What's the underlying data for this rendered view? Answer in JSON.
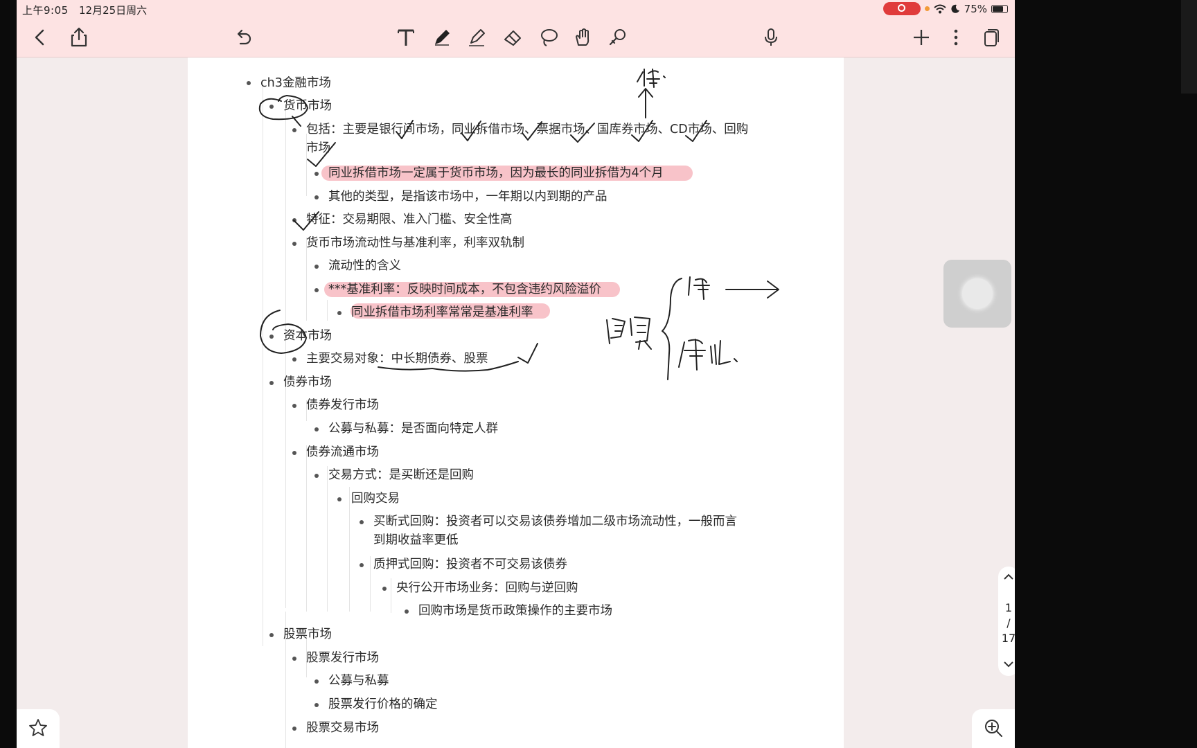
{
  "status_bar": {
    "time": "上午9:05",
    "date": "12月25日周六",
    "battery": "75%"
  },
  "toolbar": {
    "left_icons": [
      "back-icon",
      "share-icon",
      "undo-icon"
    ],
    "tools": [
      "text-tool-icon",
      "pen-icon",
      "highlighter-icon",
      "eraser-icon",
      "lasso-icon",
      "hand-icon",
      "shape-tool-icon"
    ],
    "right_icons": [
      "microphone-icon",
      "plus-icon",
      "more-icon",
      "pages-icon"
    ]
  },
  "outline": {
    "root": "ch3金融市场",
    "money_market": "货币市场",
    "mm_include": "包括：主要是银行间市场，同业拆借市场、票据市场、国库券市场、CD市场、回购市场",
    "mm_include_a": "同业拆借市场一定属于货币市场，因为最长的同业拆借为4个月",
    "mm_include_b": "其他的类型，是指该市场中，一年期以内到期的产品",
    "mm_feature": "特征：交易期限、准入门槛、安全性高",
    "mm_rate": "货币市场流动性与基准利率，利率双轨制",
    "mm_rate_a": "流动性的含义",
    "mm_rate_b": "***基准利率：反映时间成本，不包含违约风险溢价",
    "mm_rate_b1": "同业拆借市场利率常常是基准利率",
    "capital_market": "资本市场",
    "cm_object": "主要交易对象：中长期债券、股票",
    "bond_market": "债券市场",
    "bm_issue": "债券发行市场",
    "bm_issue_a": "公募与私募：是否面向特定人群",
    "bm_trade": "债券流通市场",
    "bm_trade_a": "交易方式：是买断还是回购",
    "bm_repo": "回购交易",
    "bm_repo_a": "买断式回购：投资者可以交易该债券增加二级市场流动性，一般而言到期收益率更低",
    "bm_repo_b": "质押式回购：投资者不可交易该债券",
    "bm_repo_b1": "央行公开市场业务：回购与逆回购",
    "bm_repo_b2": "回购市场是货币政策操作的主要市场",
    "stock_market": "股票市场",
    "sm_issue": "股票发行市场",
    "sm_issue_a": "公募与私募",
    "sm_issue_b": "股票发行价格的确定",
    "sm_trade": "股票交易市场"
  },
  "pager": {
    "current": "1",
    "separator": "/",
    "total": "17"
  },
  "colors": {
    "toolbar_bg": "#fde3e3",
    "highlight": "#f7b9bf",
    "ink": "#222222",
    "record": "#e03b3b"
  }
}
